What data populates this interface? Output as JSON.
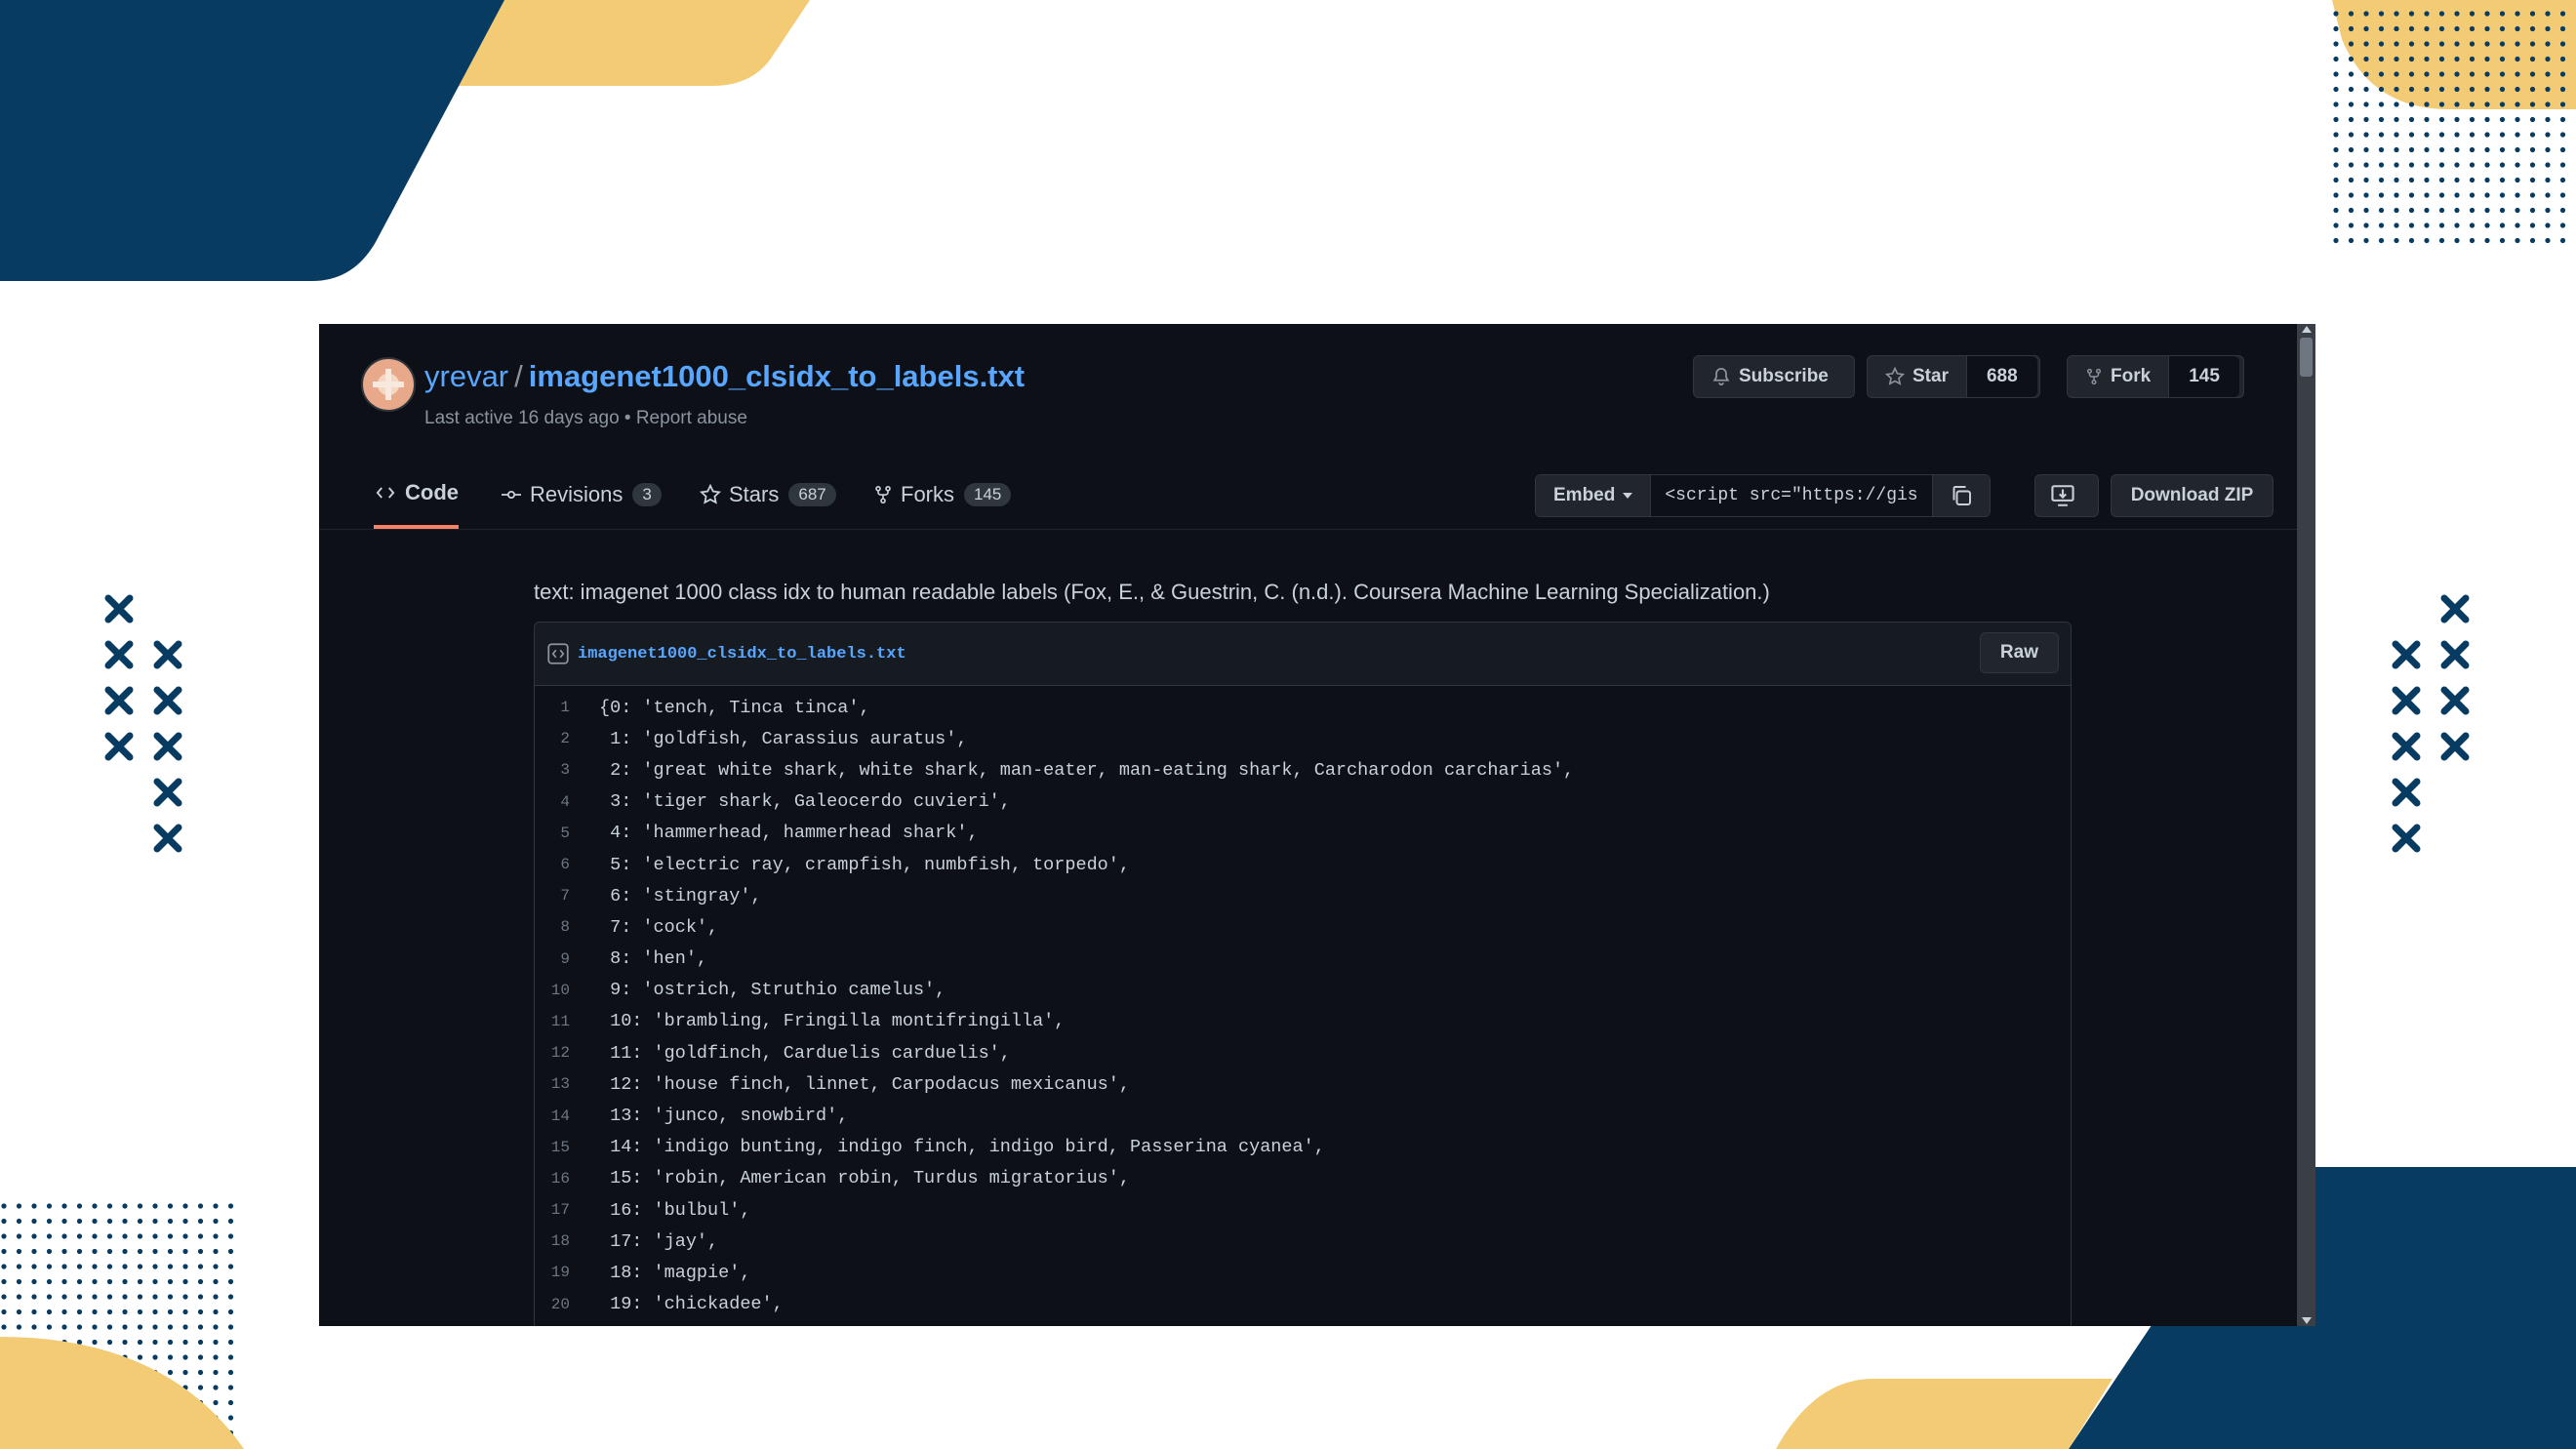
{
  "gist": {
    "owner": "yrevar",
    "separator": "/",
    "name": "imagenet1000_clsidx_to_labels.txt",
    "meta": "Last active 16 days ago • Report abuse"
  },
  "actions": {
    "subscribe": "Subscribe",
    "star": "Star",
    "star_count": "688",
    "fork": "Fork",
    "fork_count": "145"
  },
  "tabs": [
    {
      "label": "Code",
      "count": ""
    },
    {
      "label": "Revisions",
      "count": "3"
    },
    {
      "label": "Stars",
      "count": "687"
    },
    {
      "label": "Forks",
      "count": "145"
    }
  ],
  "embed": {
    "label": "Embed",
    "value": "<script src=\"https://gis",
    "download": "Download ZIP"
  },
  "description": "text: imagenet 1000 class idx to human readable labels (Fox, E., & Guestrin, C. (n.d.). Coursera Machine Learning Specialization.)",
  "file": {
    "name": "imagenet1000_clsidx_to_labels.txt",
    "raw": "Raw",
    "lines": [
      {
        "n": "1",
        "text": "{0: 'tench, Tinca tinca',"
      },
      {
        "n": "2",
        "text": " 1: 'goldfish, Carassius auratus',"
      },
      {
        "n": "3",
        "text": " 2: 'great white shark, white shark, man-eater, man-eating shark, Carcharodon carcharias',"
      },
      {
        "n": "4",
        "text": " 3: 'tiger shark, Galeocerdo cuvieri',"
      },
      {
        "n": "5",
        "text": " 4: 'hammerhead, hammerhead shark',"
      },
      {
        "n": "6",
        "text": " 5: 'electric ray, crampfish, numbfish, torpedo',"
      },
      {
        "n": "7",
        "text": " 6: 'stingray',"
      },
      {
        "n": "8",
        "text": " 7: 'cock',"
      },
      {
        "n": "9",
        "text": " 8: 'hen',"
      },
      {
        "n": "10",
        "text": " 9: 'ostrich, Struthio camelus',"
      },
      {
        "n": "11",
        "text": " 10: 'brambling, Fringilla montifringilla',"
      },
      {
        "n": "12",
        "text": " 11: 'goldfinch, Carduelis carduelis',"
      },
      {
        "n": "13",
        "text": " 12: 'house finch, linnet, Carpodacus mexicanus',"
      },
      {
        "n": "14",
        "text": " 13: 'junco, snowbird',"
      },
      {
        "n": "15",
        "text": " 14: 'indigo bunting, indigo finch, indigo bird, Passerina cyanea',"
      },
      {
        "n": "16",
        "text": " 15: 'robin, American robin, Turdus migratorius',"
      },
      {
        "n": "17",
        "text": " 16: 'bulbul',"
      },
      {
        "n": "18",
        "text": " 17: 'jay',"
      },
      {
        "n": "19",
        "text": " 18: 'magpie',"
      },
      {
        "n": "20",
        "text": " 19: 'chickadee',"
      }
    ]
  },
  "colors": {
    "navy": "#073b62",
    "yellow": "#f2cb74",
    "bg_dark": "#0d1117",
    "link": "#58a6ff",
    "accent_tab": "#f78166"
  }
}
